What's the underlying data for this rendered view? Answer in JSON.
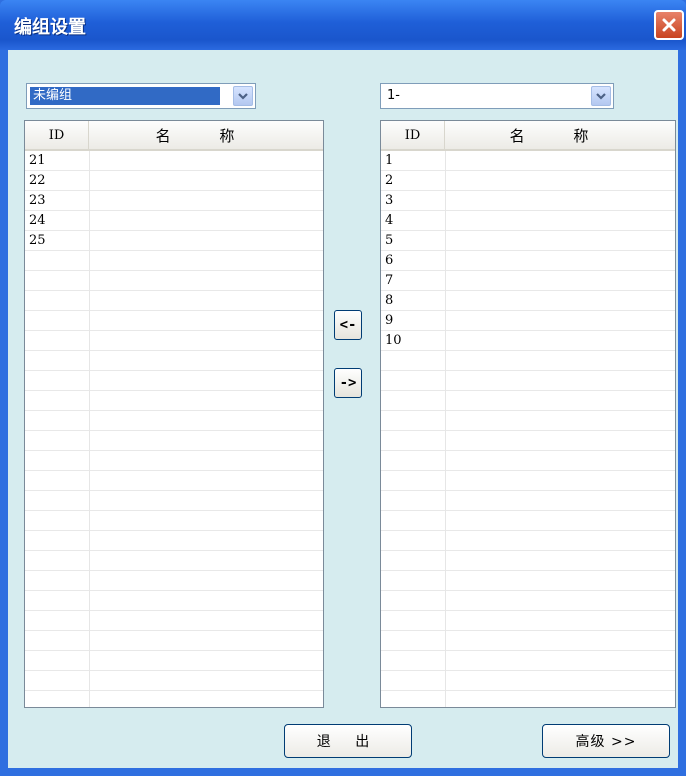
{
  "window": {
    "title": "编组设置"
  },
  "left_combo": {
    "value": "未编组"
  },
  "right_combo": {
    "value": "1-"
  },
  "left_list": {
    "headers": {
      "id": "ID",
      "name": "名  称"
    },
    "rows": [
      {
        "id": "21",
        "name": ""
      },
      {
        "id": "22",
        "name": ""
      },
      {
        "id": "23",
        "name": ""
      },
      {
        "id": "24",
        "name": ""
      },
      {
        "id": "25",
        "name": ""
      }
    ]
  },
  "right_list": {
    "headers": {
      "id": "ID",
      "name": "名  称"
    },
    "rows": [
      {
        "id": "1",
        "name": ""
      },
      {
        "id": "2",
        "name": ""
      },
      {
        "id": "3",
        "name": ""
      },
      {
        "id": "4",
        "name": ""
      },
      {
        "id": "5",
        "name": ""
      },
      {
        "id": "6",
        "name": ""
      },
      {
        "id": "7",
        "name": ""
      },
      {
        "id": "8",
        "name": ""
      },
      {
        "id": "9",
        "name": ""
      },
      {
        "id": "10",
        "name": ""
      }
    ]
  },
  "buttons": {
    "move_left": "<-",
    "move_right": "->",
    "exit": "退 出",
    "advanced": "高级 >>"
  },
  "icons": {
    "close": "close-icon",
    "dropdown": "chevron-down-icon"
  },
  "colors": {
    "titlebar": "#1f5fd8",
    "frame": "#2f6fe0",
    "client": "#d6ecef",
    "close": "#c9431f",
    "selection": "#316ac5"
  }
}
